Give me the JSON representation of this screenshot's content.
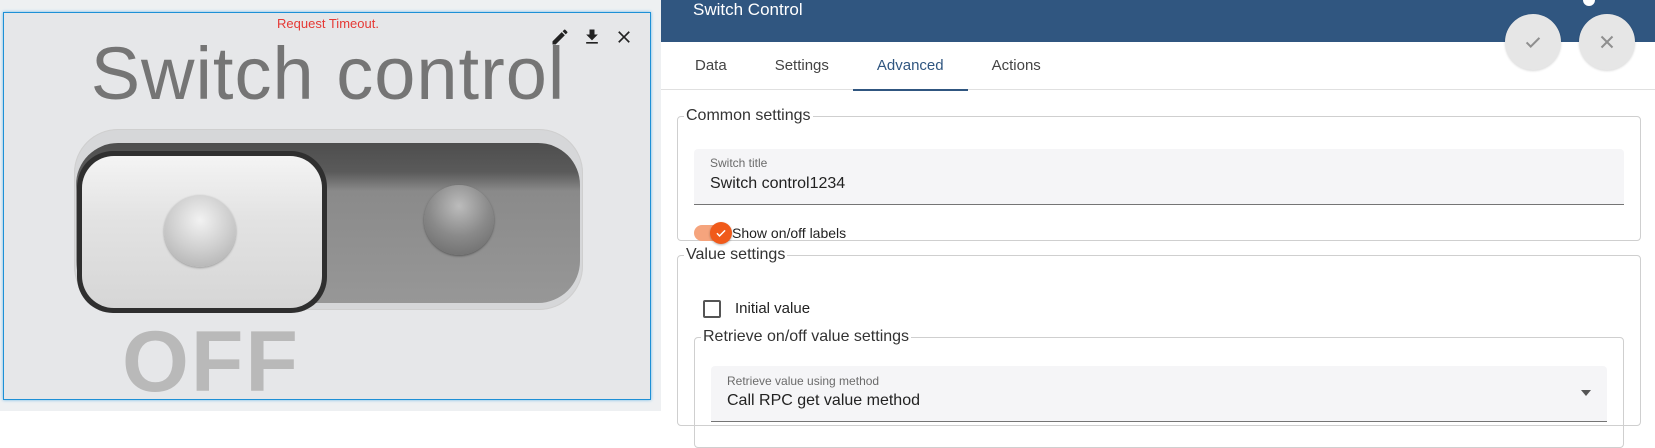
{
  "widget": {
    "error": "Request Timeout.",
    "title": "Switch control",
    "state_label": "OFF",
    "toolbar": [
      "edit-icon",
      "download-icon",
      "close-icon"
    ]
  },
  "panel": {
    "title": "Switch Control",
    "tabs": [
      {
        "label": "Data",
        "active": false
      },
      {
        "label": "Settings",
        "active": false
      },
      {
        "label": "Advanced",
        "active": true
      },
      {
        "label": "Actions",
        "active": false
      }
    ],
    "common": {
      "legend": "Common settings",
      "switch_title_label": "Switch title",
      "switch_title_value": "Switch control1234",
      "show_labels_text": "Show on/off labels",
      "show_labels_on": true
    },
    "value": {
      "legend": "Value settings",
      "initial_value_label": "Initial value",
      "initial_value_checked": false,
      "retrieve": {
        "legend": "Retrieve on/off value settings",
        "method_label": "Retrieve value using method",
        "method_value": "Call RPC get value method"
      }
    }
  },
  "colors": {
    "header": "#305680",
    "accent": "#f05a1a",
    "error": "#e53935"
  }
}
